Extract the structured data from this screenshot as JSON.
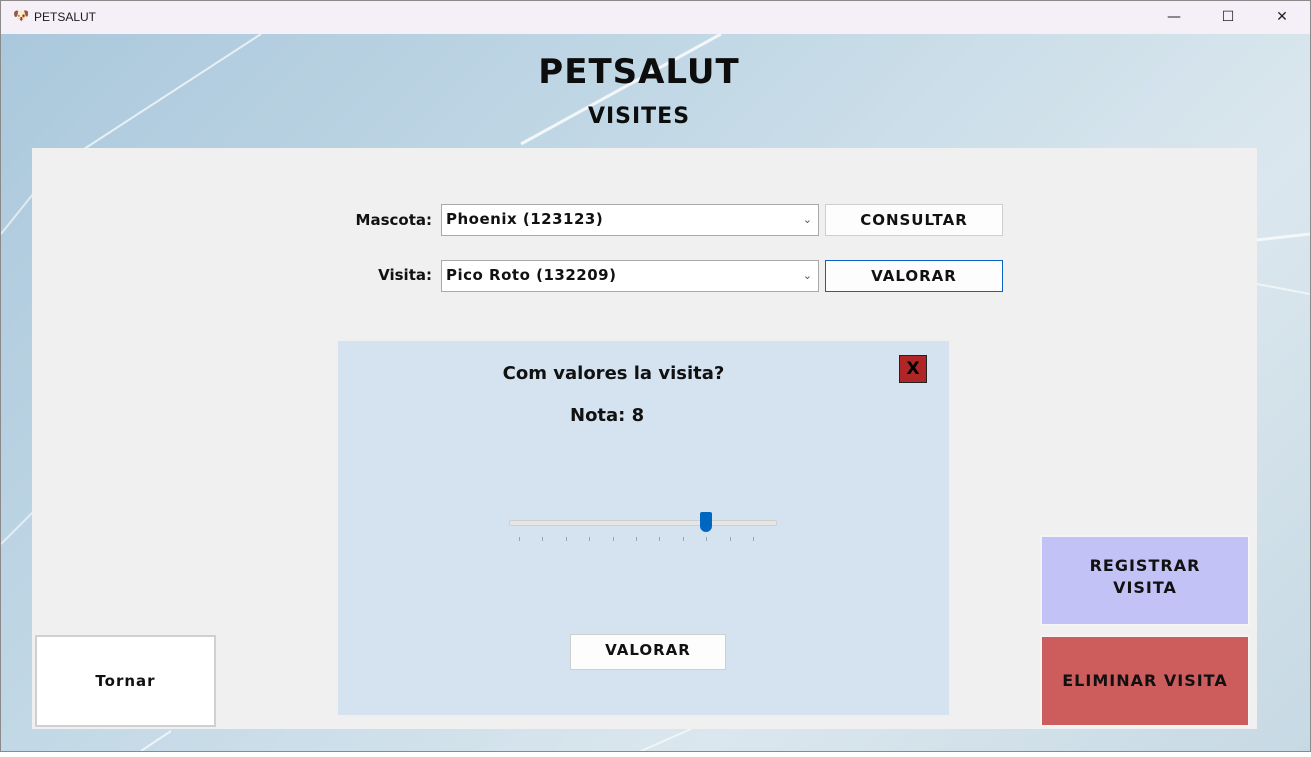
{
  "window": {
    "title": "PETSALUT",
    "controls": [
      "—",
      "☐",
      "✕"
    ]
  },
  "header": {
    "title": "PETSALUT",
    "subtitle": "VISITES"
  },
  "form": {
    "pet_label": "Mascota:",
    "pet_value": "Phoenix (123123)",
    "consult_button": "CONSULTAR",
    "visit_label": "Visita:",
    "visit_value": "Pico Roto (132209)",
    "rate_button": "VALORAR"
  },
  "rating_dialog": {
    "question": "Com valores la visita?",
    "close_label": "X",
    "score_text": "Nota: 8",
    "slider": {
      "min": 0,
      "max": 10,
      "value": 8
    },
    "submit_button": "VALORAR"
  },
  "actions": {
    "back_button": "Tornar",
    "register_line1": "REGISTRAR",
    "register_line2": "VISITA",
    "delete_button": "ELIMINAR VISITA"
  },
  "colors": {
    "register_bg": "#c2c2f7",
    "delete_bg": "#cd5c5c",
    "dialog_bg": "#d5e3f0",
    "close_bg": "#b02525",
    "slider_accent": "#0067c0"
  }
}
